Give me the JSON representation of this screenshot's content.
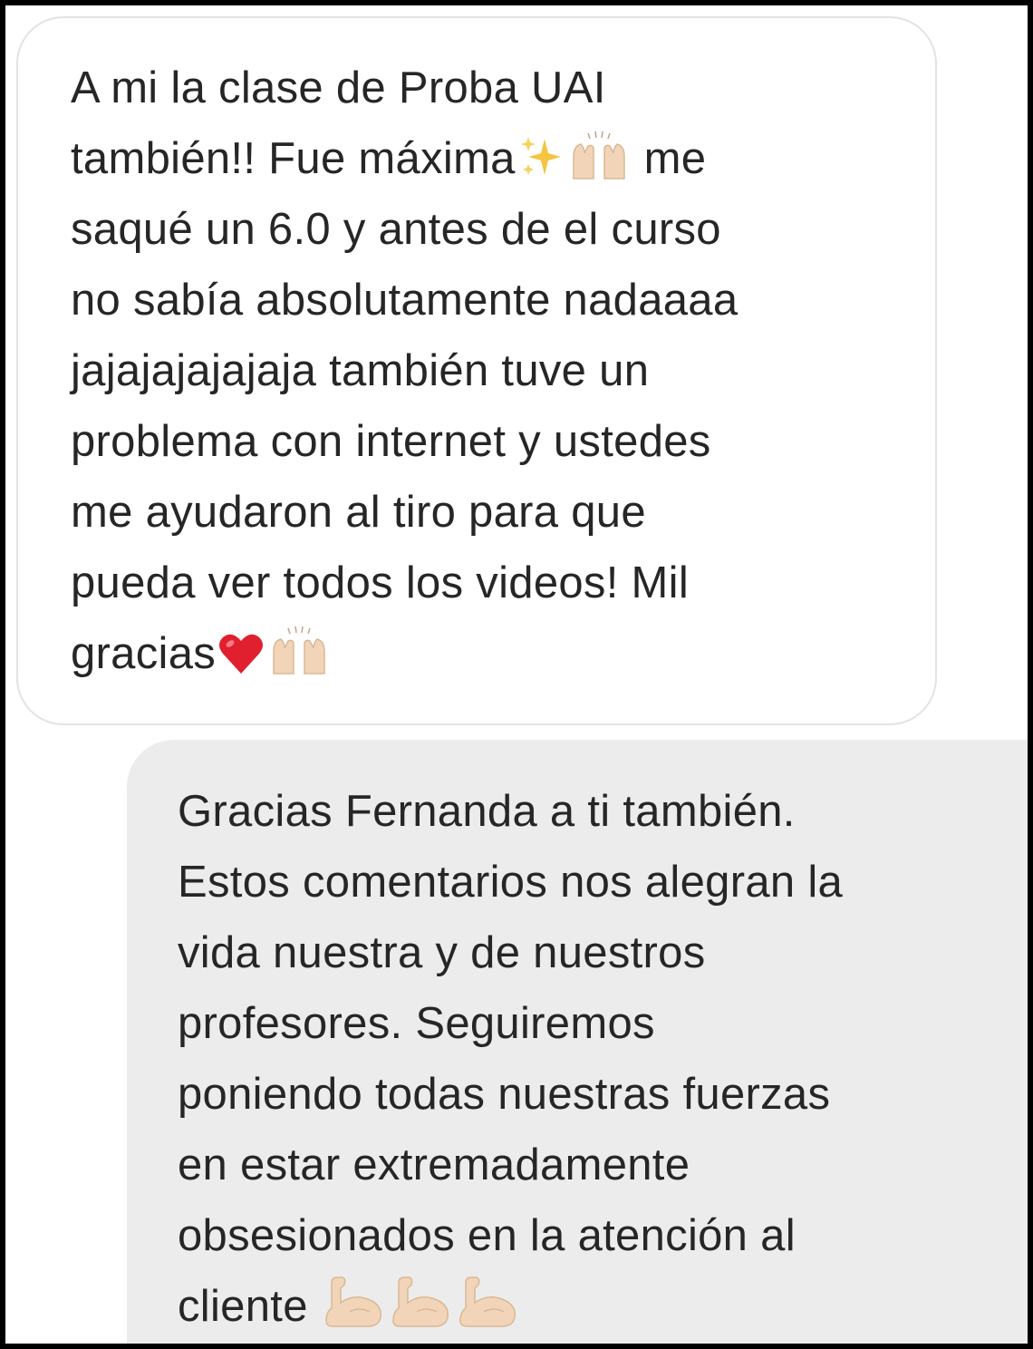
{
  "conversation": {
    "received_message": {
      "lines": [
        "A mi la clase de Proba UAI",
        "también!! Fue máxima",
        "me",
        "saqué un 6.0 y antes de el curso",
        "no sabía absolutamente nadaaaa",
        "jajajajajajaja también tuve un",
        "problema con internet y ustedes",
        "me ayudaron al tiro para que",
        "pueda ver todos los videos! Mil",
        "gracias"
      ],
      "emojis": [
        "sparkles-icon",
        "raising-hands-icon",
        "red-heart-icon",
        "raising-hands-icon"
      ]
    },
    "sent_message": {
      "lines": [
        "Gracias Fernanda a ti también.",
        "Estos comentarios nos alegran la",
        "vida nuestra y de nuestros",
        "profesores. Seguiremos",
        "poniendo todas nuestras fuerzas",
        "en estar extremadamente",
        "obsesionados en la atención al",
        "cliente"
      ],
      "emojis": [
        "flexed-biceps-icon",
        "flexed-biceps-icon",
        "flexed-biceps-icon"
      ]
    }
  },
  "colors": {
    "frame_border": "#000000",
    "page_background": "#ffffff",
    "received_bubble": "#ffffff",
    "received_bubble_border": "#e3e3e3",
    "sent_bubble": "#ececec",
    "text": "#262626",
    "heart": "#e0202e",
    "sparkles": "#f5c542",
    "skin_tone": "#f2d5b8"
  }
}
